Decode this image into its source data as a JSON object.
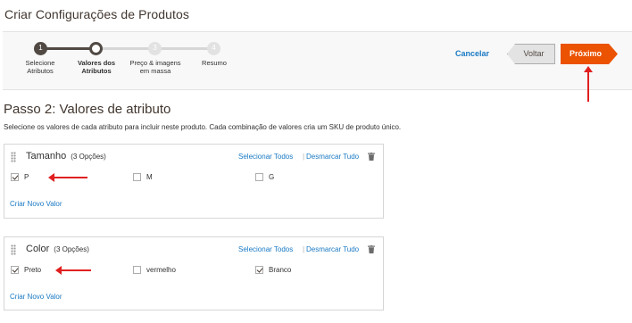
{
  "page": {
    "title": "Criar Configurações de Produtos"
  },
  "wizard": {
    "steps": [
      {
        "num": "1",
        "label": "Selecione Atributos",
        "state": "done"
      },
      {
        "num": "2",
        "label": "Valores dos Atributos",
        "state": "current"
      },
      {
        "num": "3",
        "label": "Preço & imagens em massa",
        "state": "todo"
      },
      {
        "num": "4",
        "label": "Resumo",
        "state": "todo"
      }
    ],
    "cancel_label": "Cancelar",
    "back_label": "Voltar",
    "next_label": "Próximo"
  },
  "step": {
    "title": "Passo 2: Valores de atributo",
    "description": "Selecione os valores de cada atributo para incluir neste produto. Cada combinação de valores cria um SKU de produto único."
  },
  "attributes": [
    {
      "name": "Tamanho",
      "count": "(3 Opções)",
      "select_all": "Selecionar Todos",
      "deselect_all": "Desmarcar Tudo",
      "options": [
        {
          "label": "P",
          "checked": true
        },
        {
          "label": "M",
          "checked": false
        },
        {
          "label": "G",
          "checked": false
        }
      ],
      "create_value": "Criar Novo Valor"
    },
    {
      "name": "Color",
      "count": "(3 Opções)",
      "select_all": "Selecionar Todos",
      "deselect_all": "Desmarcar Tudo",
      "options": [
        {
          "label": "Preto",
          "checked": true
        },
        {
          "label": "vermelho",
          "checked": false
        },
        {
          "label": "Branco",
          "checked": true
        }
      ],
      "create_value": "Criar Novo Valor"
    }
  ],
  "colors": {
    "accent": "#eb5202",
    "link": "#1979c3",
    "annotation": "#e02020"
  }
}
